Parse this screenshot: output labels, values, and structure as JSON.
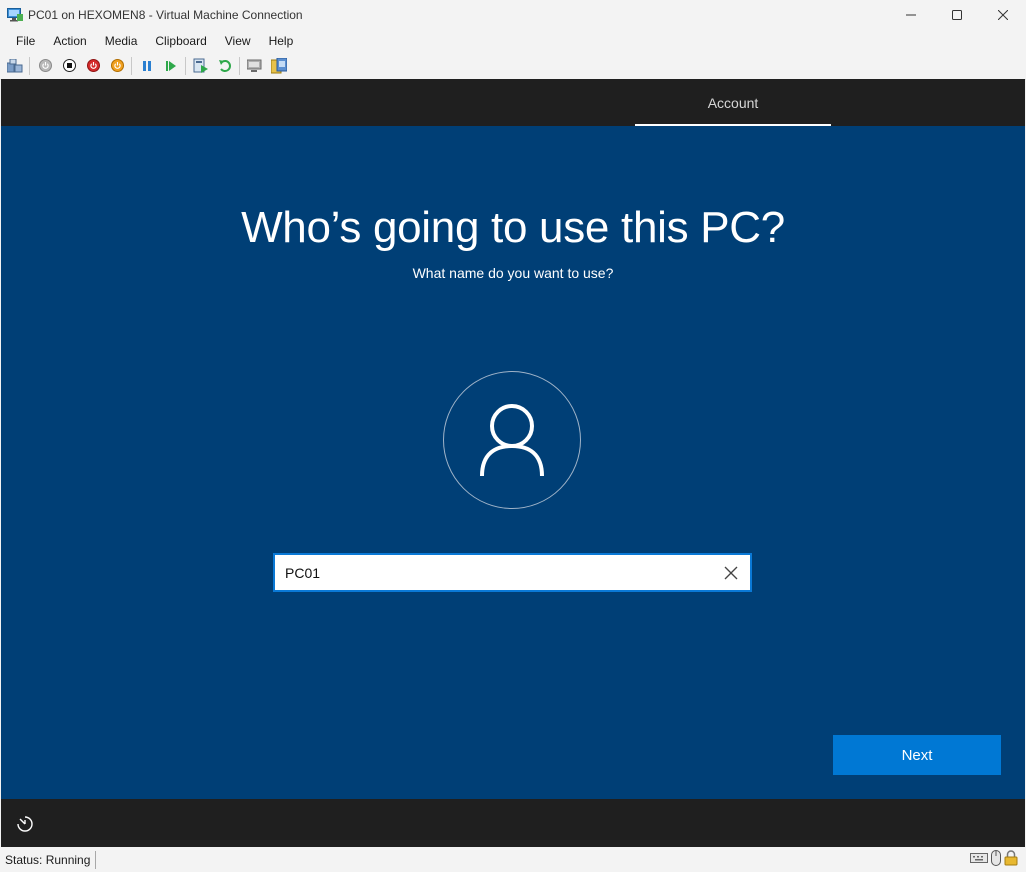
{
  "window": {
    "title": "PC01 on HEXOMEN8 - Virtual Machine Connection"
  },
  "menu": {
    "items": [
      "File",
      "Action",
      "Media",
      "Clipboard",
      "View",
      "Help"
    ]
  },
  "toolbar": {
    "icons": [
      "ctrl-alt-del-icon",
      "start-icon",
      "turn-off-icon",
      "shut-down-icon",
      "save-icon",
      "pause-icon",
      "resume-icon",
      "checkpoint-icon",
      "revert-icon",
      "enhanced-session-icon",
      "share-icon"
    ]
  },
  "setup": {
    "tab_label": "Account",
    "heading": "Who’s going to use this PC?",
    "subheading": "What name do you want to use?",
    "name_value": "PC01",
    "next_label": "Next"
  },
  "status": {
    "text": "Status: Running"
  },
  "colors": {
    "oobe_background": "#003f76",
    "accent": "#0078d4",
    "header_bar": "#1f1f1f"
  }
}
